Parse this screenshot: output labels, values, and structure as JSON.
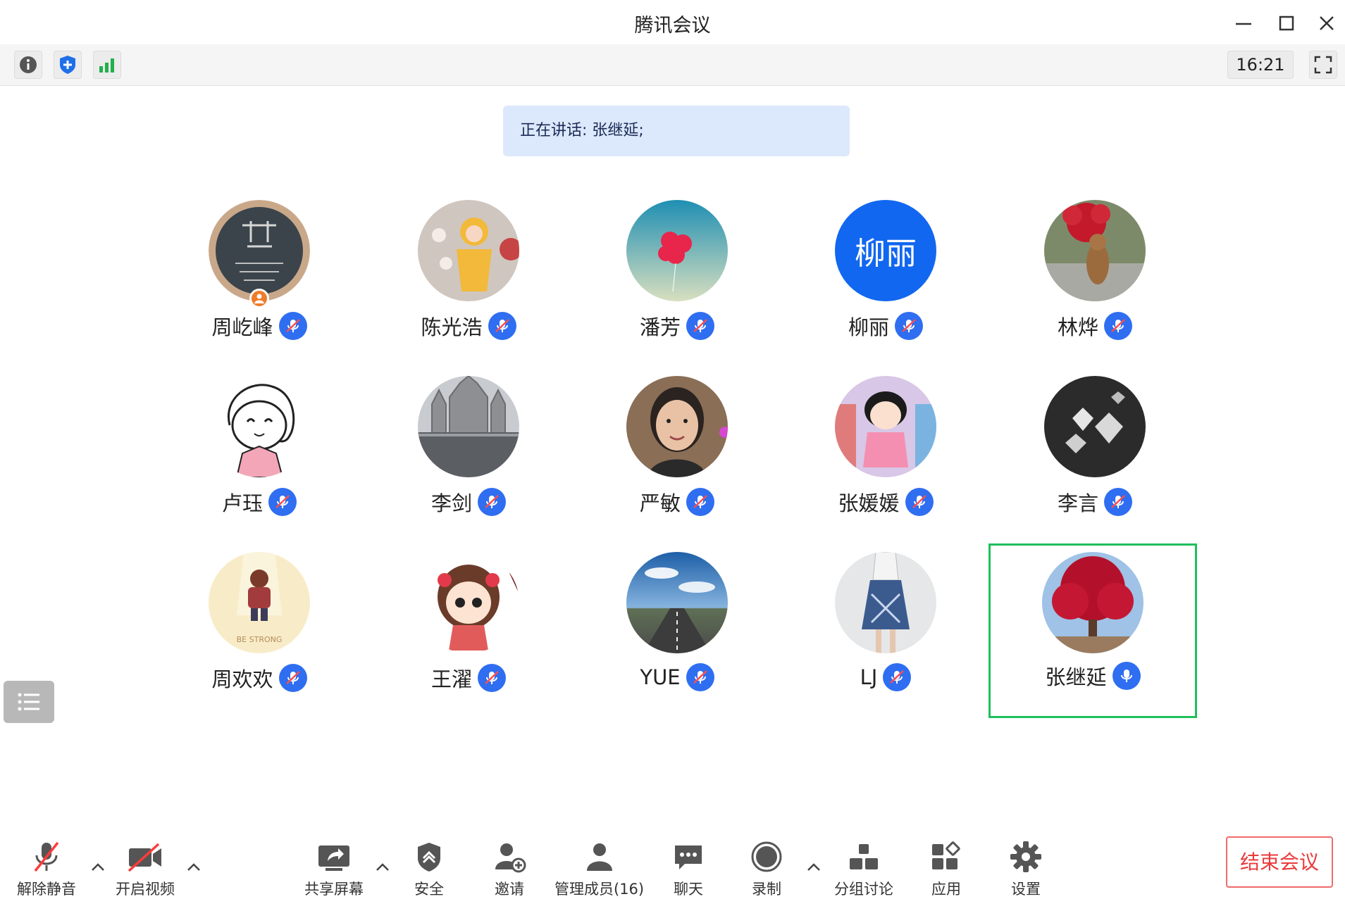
{
  "window": {
    "title": "腾讯会议"
  },
  "topbar": {
    "time": "16:21"
  },
  "speaking": {
    "text": "正在讲话: 张继延;"
  },
  "participants": [
    {
      "name": "周屹峰",
      "mic": "muted",
      "host": true,
      "avatar": "circle-avatar"
    },
    {
      "name": "陈光浩",
      "mic": "muted",
      "avatar": "cartoon-girl"
    },
    {
      "name": "潘芳",
      "mic": "muted",
      "avatar": "pink-balloons"
    },
    {
      "name": "柳丽",
      "mic": "muted",
      "avatar_text": "柳丽",
      "avatar": "text-avatar"
    },
    {
      "name": "林烨",
      "mic": "muted",
      "avatar": "squirrel-flower"
    },
    {
      "name": "卢珏",
      "mic": "muted",
      "avatar": "sketch-girl"
    },
    {
      "name": "李剑",
      "mic": "muted",
      "avatar": "cathedral"
    },
    {
      "name": "严敏",
      "mic": "muted",
      "avatar": "photo-woman"
    },
    {
      "name": "张媛媛",
      "mic": "muted",
      "avatar": "cartoon-chibi"
    },
    {
      "name": "李言",
      "mic": "muted",
      "avatar": "diamonds"
    },
    {
      "name": "周欢欢",
      "mic": "muted",
      "avatar": "be-strong",
      "avatar_text": "BE STRONG"
    },
    {
      "name": "王濯",
      "mic": "muted",
      "avatar": "cartoon-girl-bow"
    },
    {
      "name": "YUE",
      "mic": "muted",
      "avatar": "road-sky"
    },
    {
      "name": "LJ",
      "mic": "muted",
      "avatar": "fashion"
    },
    {
      "name": "张继延",
      "mic": "active",
      "speaking": true,
      "avatar": "red-tree"
    }
  ],
  "bottom_toolbar": {
    "unmute": "解除静音",
    "start_video": "开启视频",
    "share_screen": "共享屏幕",
    "security": "安全",
    "invite": "邀请",
    "manage_members": "管理成员(16)",
    "chat": "聊天",
    "record": "录制",
    "breakout": "分组讨论",
    "apps": "应用",
    "settings": "设置",
    "end_meeting": "结束会议"
  },
  "colors": {
    "accent": "#2f6ef1",
    "active_border": "#1fbf5b",
    "end_red": "#e83b3b"
  }
}
